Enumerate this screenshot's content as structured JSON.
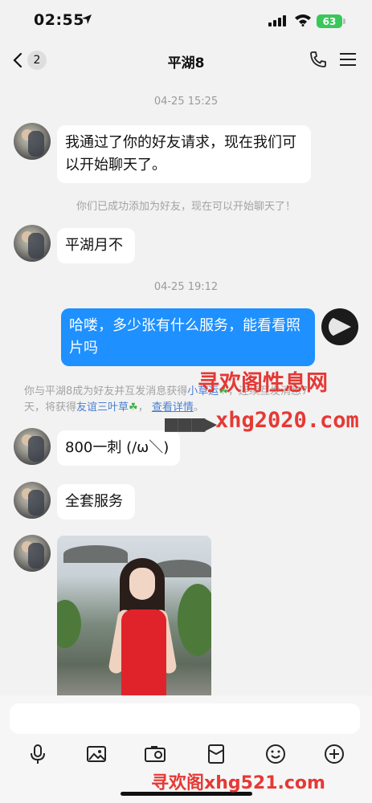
{
  "status_bar": {
    "time": "02:55",
    "battery": "63"
  },
  "nav": {
    "back_count": "2",
    "title": "平湖8"
  },
  "timestamps": [
    "04-25 15:25",
    "04-25 19:12"
  ],
  "messages": [
    {
      "sender": "contact",
      "text": "我通过了你的好友请求，现在我们可以开始聊天了。"
    },
    {
      "sender": "contact",
      "text": "平湖月不"
    },
    {
      "sender": "me",
      "text": "哈喽，多少张有什么服务，能看看照片吗"
    },
    {
      "sender": "contact",
      "text": "800一刺 (/ω＼)"
    },
    {
      "sender": "contact",
      "text": "全套服务"
    },
    {
      "sender": "contact",
      "type": "photo"
    }
  ],
  "system_notes": {
    "added": "你们已成功添加为好友，现在可以开始聊天了！",
    "friend_line1_a": "你与平湖8成为好友并互发消息获得",
    "friend_link1": "小草运",
    "friend_line1_b": "，连续互发消息7",
    "friend_line2_a": "天，将获得",
    "friend_link2": "友谊三叶草",
    "friend_sep": "，",
    "friend_link3": "查看详情",
    "friend_end": "。",
    "clover_icon": "clover-icon"
  },
  "watermarks": {
    "top_cn": "寻欢阁性息网",
    "top_url": "xhg2020.com",
    "bottom": "寻欢阁xhg521.com"
  },
  "input": {
    "placeholder": ""
  },
  "toolbar": [
    "microphone-icon",
    "image-icon",
    "camera-icon",
    "red-packet-icon",
    "emoji-icon",
    "plus-icon"
  ],
  "colors": {
    "my_bubble": "#1e90ff",
    "watermark": "#e53935",
    "link": "#4a7fd1"
  }
}
